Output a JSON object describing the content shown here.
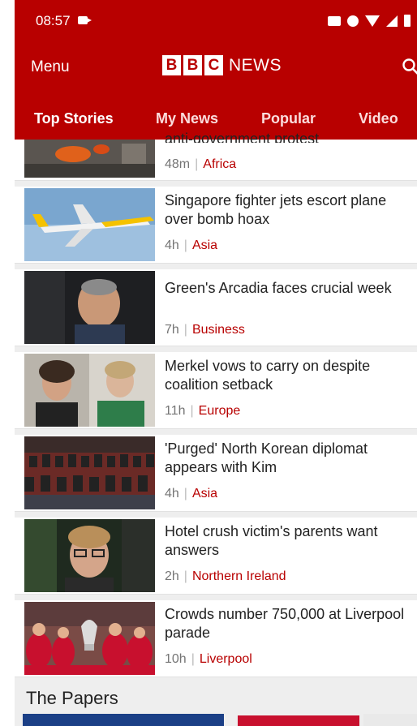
{
  "status": {
    "time": "08:57"
  },
  "header": {
    "menu_label": "Menu",
    "logo": {
      "letters": [
        "B",
        "B",
        "C"
      ],
      "news": "NEWS"
    }
  },
  "tabs": [
    {
      "label": "Top Stories",
      "active": true
    },
    {
      "label": "My News",
      "active": false
    },
    {
      "label": "Popular",
      "active": false
    },
    {
      "label": "Video",
      "active": false
    }
  ],
  "stories": [
    {
      "headline": "anti-government protest",
      "time": "48m",
      "category": "Africa"
    },
    {
      "headline": "Singapore fighter jets escort plane over bomb hoax",
      "time": "4h",
      "category": "Asia"
    },
    {
      "headline": "Green's Arcadia faces crucial week",
      "time": "7h",
      "category": "Business"
    },
    {
      "headline": "Merkel vows to carry on despite coalition setback",
      "time": "11h",
      "category": "Europe"
    },
    {
      "headline": "'Purged' North Korean diplomat appears with Kim",
      "time": "4h",
      "category": "Asia"
    },
    {
      "headline": "Hotel crush victim's parents want answers",
      "time": "2h",
      "category": "Northern Ireland"
    },
    {
      "headline": "Crowds number 750,000 at Liverpool parade",
      "time": "10h",
      "category": "Liverpool"
    }
  ],
  "papers": {
    "title": "The Papers"
  },
  "colors": {
    "brand_red": "#b80000",
    "link_red": "#b80000"
  }
}
